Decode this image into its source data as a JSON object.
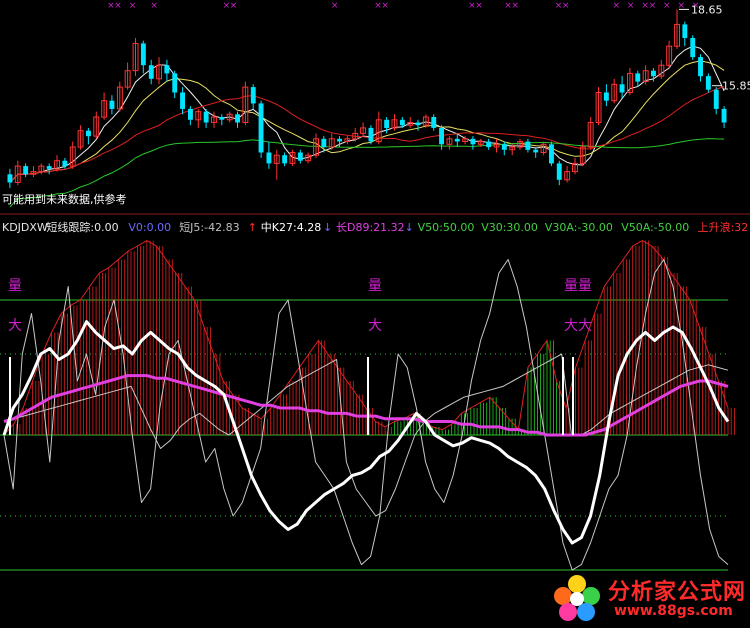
{
  "colors": {
    "background": "#000000",
    "up": "#ff3333",
    "down": "#00e5ff",
    "ma_white": "#f0f0f0",
    "ma_yellow": "#e8e060",
    "ma_red": "#e02020",
    "ma_green": "#28c828",
    "label_name": "#e8e8e8",
    "label_v0": "#6a6aff",
    "label_short": "#c0c0c0",
    "label_mid": "#ffffff",
    "label_long": "#e040e0",
    "label_v": "#40d040",
    "label_up": "#ff3030",
    "hist_red": "#e02020",
    "hist_green": "#20d020",
    "line_white": "#ffffff",
    "line_magenta": "#e040e0",
    "line_gray": "#c8c8c8",
    "guide_green": "#30c030",
    "marker_magenta": "#d020d0",
    "watermark": "#ff2a2a"
  },
  "price_panel": {
    "high_label": "18.65",
    "right_label": "15.85",
    "warning_text": "可能用到未来数据,供参考"
  },
  "indicator_row": [
    {
      "key": "name",
      "text": "KDJDXW",
      "color": "label_name"
    },
    {
      "key": "short_track",
      "text": "短线跟踪:0.00",
      "color": "label_name"
    },
    {
      "key": "v0",
      "text": "V0:0.00",
      "color": "label_v0"
    },
    {
      "key": "short_j",
      "text": "短J5:-42.83",
      "color": "label_short",
      "arrow": "↑",
      "arrow_color": "label_up"
    },
    {
      "key": "mid_k",
      "text": "中K27:4.28",
      "color": "label_mid",
      "arrow": "↓",
      "arrow_color": "label_v0"
    },
    {
      "key": "long_d",
      "text": "长D89:21.32",
      "color": "label_long",
      "arrow": "↓",
      "arrow_color": "label_v0"
    },
    {
      "key": "v50",
      "text": "V50:50.00",
      "color": "label_v"
    },
    {
      "key": "v30",
      "text": "V30:30.00",
      "color": "label_v"
    },
    {
      "key": "v30a",
      "text": "V30A:-30.00",
      "color": "label_v"
    },
    {
      "key": "v50a",
      "text": "V50A:-50.00",
      "color": "label_v"
    },
    {
      "key": "up_wave",
      "text": "上升浪:32",
      "color": "label_up"
    }
  ],
  "signal_markers": [
    {
      "text": "量",
      "pos": "left"
    },
    {
      "text": "大",
      "pos": "left"
    },
    {
      "text": "量",
      "pos": "mid"
    },
    {
      "text": "大",
      "pos": "mid"
    },
    {
      "text": "量量",
      "pos": "right"
    },
    {
      "text": "大大",
      "pos": "right"
    }
  ],
  "chart_data": [
    {
      "type": "candlestick",
      "panel": "price",
      "title": "",
      "y_markers": [
        18.65,
        15.85
      ],
      "candles": [
        {
          "o": 12.6,
          "c": 12.3,
          "h": 12.8,
          "l": 12.1
        },
        {
          "o": 12.3,
          "c": 12.9,
          "h": 13.1,
          "l": 12.2
        },
        {
          "o": 12.9,
          "c": 12.6,
          "h": 13.0,
          "l": 12.5
        },
        {
          "o": 12.6,
          "c": 12.7,
          "h": 12.9,
          "l": 12.5
        },
        {
          "o": 12.7,
          "c": 12.9,
          "h": 13.0,
          "l": 12.6
        },
        {
          "o": 12.9,
          "c": 12.8,
          "h": 13.0,
          "l": 12.6
        },
        {
          "o": 12.8,
          "c": 13.1,
          "h": 13.3,
          "l": 12.7
        },
        {
          "o": 13.1,
          "c": 12.9,
          "h": 13.2,
          "l": 12.8
        },
        {
          "o": 12.9,
          "c": 13.6,
          "h": 13.8,
          "l": 12.8
        },
        {
          "o": 13.6,
          "c": 14.2,
          "h": 14.4,
          "l": 13.5
        },
        {
          "o": 14.2,
          "c": 14.0,
          "h": 14.3,
          "l": 13.7
        },
        {
          "o": 14.0,
          "c": 14.7,
          "h": 14.9,
          "l": 13.9
        },
        {
          "o": 14.7,
          "c": 15.3,
          "h": 15.6,
          "l": 14.6
        },
        {
          "o": 15.3,
          "c": 15.0,
          "h": 15.5,
          "l": 14.8
        },
        {
          "o": 15.0,
          "c": 15.8,
          "h": 16.0,
          "l": 14.9
        },
        {
          "o": 15.8,
          "c": 16.4,
          "h": 16.7,
          "l": 15.7
        },
        {
          "o": 16.4,
          "c": 17.4,
          "h": 17.6,
          "l": 16.2
        },
        {
          "o": 17.4,
          "c": 16.6,
          "h": 17.5,
          "l": 16.3
        },
        {
          "o": 16.6,
          "c": 16.1,
          "h": 16.8,
          "l": 15.9
        },
        {
          "o": 16.1,
          "c": 16.6,
          "h": 16.9,
          "l": 15.9
        },
        {
          "o": 16.6,
          "c": 16.3,
          "h": 16.8,
          "l": 16.0
        },
        {
          "o": 16.3,
          "c": 15.6,
          "h": 16.4,
          "l": 15.4
        },
        {
          "o": 15.6,
          "c": 15.0,
          "h": 15.8,
          "l": 14.8
        },
        {
          "o": 15.0,
          "c": 14.6,
          "h": 15.1,
          "l": 14.4
        },
        {
          "o": 14.6,
          "c": 14.9,
          "h": 15.0,
          "l": 14.3
        },
        {
          "o": 14.9,
          "c": 14.5,
          "h": 15.0,
          "l": 14.3
        },
        {
          "o": 14.5,
          "c": 14.7,
          "h": 14.9,
          "l": 14.3
        },
        {
          "o": 14.7,
          "c": 14.6,
          "h": 14.8,
          "l": 14.4
        },
        {
          "o": 14.6,
          "c": 14.8,
          "h": 14.9,
          "l": 14.5
        },
        {
          "o": 14.8,
          "c": 14.5,
          "h": 14.9,
          "l": 14.3
        },
        {
          "o": 14.5,
          "c": 15.8,
          "h": 16.0,
          "l": 14.4
        },
        {
          "o": 15.8,
          "c": 15.2,
          "h": 15.9,
          "l": 15.0
        },
        {
          "o": 15.2,
          "c": 13.4,
          "h": 15.3,
          "l": 13.2
        },
        {
          "o": 13.4,
          "c": 13.0,
          "h": 13.8,
          "l": 12.8
        },
        {
          "o": 13.0,
          "c": 13.3,
          "h": 13.5,
          "l": 12.4
        },
        {
          "o": 13.3,
          "c": 13.0,
          "h": 13.4,
          "l": 12.9
        },
        {
          "o": 13.0,
          "c": 13.4,
          "h": 13.5,
          "l": 12.9
        },
        {
          "o": 13.4,
          "c": 13.1,
          "h": 13.5,
          "l": 13.0
        },
        {
          "o": 13.1,
          "c": 13.3,
          "h": 13.4,
          "l": 13.0
        },
        {
          "o": 13.3,
          "c": 13.9,
          "h": 14.1,
          "l": 13.2
        },
        {
          "o": 13.9,
          "c": 13.6,
          "h": 14.0,
          "l": 13.4
        },
        {
          "o": 13.6,
          "c": 13.9,
          "h": 14.1,
          "l": 13.5
        },
        {
          "o": 13.9,
          "c": 13.8,
          "h": 14.0,
          "l": 13.6
        },
        {
          "o": 13.8,
          "c": 13.9,
          "h": 14.0,
          "l": 13.7
        },
        {
          "o": 13.9,
          "c": 14.1,
          "h": 14.3,
          "l": 13.8
        },
        {
          "o": 14.1,
          "c": 14.3,
          "h": 14.5,
          "l": 14.0
        },
        {
          "o": 14.3,
          "c": 13.8,
          "h": 14.4,
          "l": 13.7
        },
        {
          "o": 13.8,
          "c": 14.6,
          "h": 14.9,
          "l": 13.7
        },
        {
          "o": 14.6,
          "c": 14.3,
          "h": 14.7,
          "l": 14.1
        },
        {
          "o": 14.3,
          "c": 14.6,
          "h": 14.8,
          "l": 14.2
        },
        {
          "o": 14.6,
          "c": 14.4,
          "h": 14.7,
          "l": 14.3
        },
        {
          "o": 14.4,
          "c": 14.5,
          "h": 14.7,
          "l": 14.3
        },
        {
          "o": 14.5,
          "c": 14.4,
          "h": 14.6,
          "l": 14.2
        },
        {
          "o": 14.4,
          "c": 14.7,
          "h": 14.8,
          "l": 14.3
        },
        {
          "o": 14.7,
          "c": 14.3,
          "h": 14.8,
          "l": 14.2
        },
        {
          "o": 14.3,
          "c": 13.7,
          "h": 14.4,
          "l": 13.5
        },
        {
          "o": 13.7,
          "c": 13.9,
          "h": 14.0,
          "l": 13.5
        },
        {
          "o": 13.9,
          "c": 13.8,
          "h": 14.1,
          "l": 13.6
        },
        {
          "o": 13.8,
          "c": 13.9,
          "h": 14.0,
          "l": 13.7
        },
        {
          "o": 13.9,
          "c": 13.7,
          "h": 14.0,
          "l": 13.5
        },
        {
          "o": 13.7,
          "c": 13.8,
          "h": 13.9,
          "l": 13.6
        },
        {
          "o": 13.8,
          "c": 13.6,
          "h": 13.9,
          "l": 13.5
        },
        {
          "o": 13.6,
          "c": 13.7,
          "h": 13.9,
          "l": 13.4
        },
        {
          "o": 13.7,
          "c": 13.5,
          "h": 13.8,
          "l": 13.3
        },
        {
          "o": 13.5,
          "c": 13.6,
          "h": 13.7,
          "l": 13.3
        },
        {
          "o": 13.6,
          "c": 13.8,
          "h": 13.9,
          "l": 13.5
        },
        {
          "o": 13.8,
          "c": 13.5,
          "h": 13.9,
          "l": 13.4
        },
        {
          "o": 13.5,
          "c": 13.4,
          "h": 13.6,
          "l": 13.2
        },
        {
          "o": 13.4,
          "c": 13.7,
          "h": 13.8,
          "l": 13.3
        },
        {
          "o": 13.7,
          "c": 13.0,
          "h": 13.8,
          "l": 12.9
        },
        {
          "o": 13.0,
          "c": 12.4,
          "h": 13.1,
          "l": 12.2
        },
        {
          "o": 12.4,
          "c": 12.7,
          "h": 12.9,
          "l": 12.3
        },
        {
          "o": 12.7,
          "c": 13.0,
          "h": 13.2,
          "l": 12.6
        },
        {
          "o": 13.0,
          "c": 13.6,
          "h": 13.8,
          "l": 12.9
        },
        {
          "o": 13.6,
          "c": 14.5,
          "h": 14.7,
          "l": 13.5
        },
        {
          "o": 14.5,
          "c": 15.6,
          "h": 15.8,
          "l": 14.4
        },
        {
          "o": 15.6,
          "c": 15.3,
          "h": 15.9,
          "l": 15.1
        },
        {
          "o": 15.3,
          "c": 15.9,
          "h": 16.1,
          "l": 15.2
        },
        {
          "o": 15.9,
          "c": 15.6,
          "h": 16.2,
          "l": 15.4
        },
        {
          "o": 15.6,
          "c": 16.3,
          "h": 16.5,
          "l": 15.5
        },
        {
          "o": 16.3,
          "c": 16.0,
          "h": 16.4,
          "l": 15.8
        },
        {
          "o": 16.0,
          "c": 16.4,
          "h": 16.6,
          "l": 15.9
        },
        {
          "o": 16.4,
          "c": 16.2,
          "h": 16.5,
          "l": 16.0
        },
        {
          "o": 16.2,
          "c": 16.6,
          "h": 16.8,
          "l": 16.1
        },
        {
          "o": 16.6,
          "c": 17.3,
          "h": 17.5,
          "l": 16.5
        },
        {
          "o": 17.3,
          "c": 18.1,
          "h": 18.65,
          "l": 17.2
        },
        {
          "o": 18.1,
          "c": 17.6,
          "h": 18.2,
          "l": 17.3
        },
        {
          "o": 17.6,
          "c": 16.9,
          "h": 17.7,
          "l": 16.8
        },
        {
          "o": 16.9,
          "c": 16.2,
          "h": 17.0,
          "l": 16.0
        },
        {
          "o": 16.2,
          "c": 15.7,
          "h": 16.3,
          "l": 15.6
        },
        {
          "o": 15.7,
          "c": 15.0,
          "h": 15.8,
          "l": 14.8
        },
        {
          "o": 15.0,
          "c": 14.5,
          "h": 15.1,
          "l": 14.3
        }
      ],
      "ma_series": [
        {
          "color": "ma_white",
          "period": 5
        },
        {
          "color": "ma_yellow",
          "period": 10
        },
        {
          "color": "ma_red",
          "period": 20
        },
        {
          "color": "ma_green",
          "period": 60
        }
      ]
    },
    {
      "type": "line",
      "panel": "indicator",
      "title": "",
      "ylim": [
        -50,
        72
      ],
      "guides": [
        50,
        30,
        0,
        -30,
        -50
      ],
      "series": [
        {
          "color": "line_white",
          "width": 3,
          "values": [
            0,
            10,
            15,
            22,
            30,
            32,
            28,
            30,
            35,
            42,
            38,
            35,
            32,
            33,
            30,
            35,
            38,
            35,
            32,
            30,
            25,
            22,
            20,
            18,
            15,
            5,
            -5,
            -15,
            -22,
            -28,
            -32,
            -35,
            -33,
            -28,
            -25,
            -22,
            -20,
            -18,
            -15,
            -14,
            -12,
            -8,
            -6,
            -2,
            3,
            8,
            5,
            0,
            -2,
            -4,
            -3,
            -1,
            -2,
            -3,
            -5,
            -8,
            -10,
            -12,
            -15,
            -20,
            -28,
            -35,
            -40,
            -38,
            -30,
            -15,
            5,
            22,
            30,
            35,
            38,
            35,
            38,
            40,
            38,
            32,
            25,
            18,
            10,
            5
          ]
        },
        {
          "color": "line_magenta",
          "width": 3,
          "values": [
            5,
            6,
            8,
            10,
            12,
            14,
            15,
            16,
            17,
            18,
            19,
            20,
            21,
            22,
            22,
            22,
            21,
            21,
            20,
            19,
            18,
            17,
            16,
            15,
            14,
            13,
            12,
            11,
            11,
            10,
            10,
            10,
            9,
            9,
            8,
            8,
            8,
            7,
            7,
            7,
            6,
            6,
            6,
            6,
            5,
            5,
            5,
            5,
            4,
            4,
            3,
            3,
            3,
            2,
            2,
            1,
            1,
            0,
            0,
            0,
            0,
            0,
            1,
            2,
            4,
            6,
            8,
            10,
            12,
            14,
            16,
            18,
            19,
            20,
            20,
            19,
            18
          ]
        },
        {
          "color": "line_gray",
          "width": 1,
          "values": [
            0,
            -20,
            30,
            45,
            20,
            -10,
            35,
            55,
            20,
            30,
            15,
            40,
            50,
            30,
            0,
            -25,
            -20,
            10,
            30,
            35,
            20,
            5,
            -10,
            -5,
            -20,
            -30,
            -25,
            -15,
            -5,
            20,
            45,
            50,
            30,
            10,
            -10,
            -15,
            -20,
            -30,
            -40,
            -48,
            -45,
            -30,
            5,
            30,
            25,
            10,
            -10,
            -20,
            -25,
            -15,
            0,
            20,
            35,
            45,
            60,
            65,
            55,
            40,
            20,
            0,
            -20,
            -40,
            -50,
            -48,
            -40,
            -30,
            -20,
            -15,
            0,
            25,
            45,
            60,
            65,
            55,
            35,
            10,
            -15,
            -35,
            -45,
            -48
          ]
        },
        {
          "color": "line_gray",
          "width": 1,
          "values": [
            5,
            6,
            7,
            8,
            9,
            10,
            11,
            12,
            13,
            14,
            15,
            16,
            17,
            18,
            10,
            2,
            -5,
            -2,
            3,
            6,
            8,
            5,
            2,
            0,
            3,
            6,
            9,
            12,
            15,
            18,
            20,
            22,
            24,
            26,
            28,
            -10,
            -20,
            -25,
            -30,
            -28,
            -20,
            -10,
            0,
            5,
            8,
            10,
            12,
            14,
            15,
            16,
            17,
            18,
            20,
            22,
            24,
            26,
            28,
            30,
            0,
            0,
            2,
            5,
            8,
            10,
            12,
            14,
            16,
            18,
            20,
            22,
            24,
            25,
            26,
            25,
            24
          ]
        }
      ],
      "histogram": {
        "values": [
          0,
          4,
          10,
          20,
          30,
          38,
          45,
          48,
          50,
          55,
          60,
          62,
          65,
          68,
          70,
          72,
          70,
          65,
          60,
          55,
          50,
          40,
          30,
          20,
          15,
          10,
          8,
          6,
          10,
          15,
          20,
          25,
          30,
          35,
          30,
          25,
          20,
          15,
          10,
          5,
          3,
          -5,
          -6,
          -8,
          -5,
          -3,
          -2,
          -4,
          -8,
          -10,
          -12,
          -14,
          -10,
          -6,
          -2,
          -25,
          -30,
          -35,
          -20,
          10,
          25,
          35,
          45,
          55,
          60,
          65,
          70,
          72,
          70,
          66,
          60,
          55,
          50,
          40,
          30,
          20,
          10
        ],
        "positive_color": "hist_red",
        "negative_color": "hist_green"
      }
    }
  ],
  "watermark": {
    "text_cn": "分析家公式网",
    "url": "www.88gs.com"
  }
}
